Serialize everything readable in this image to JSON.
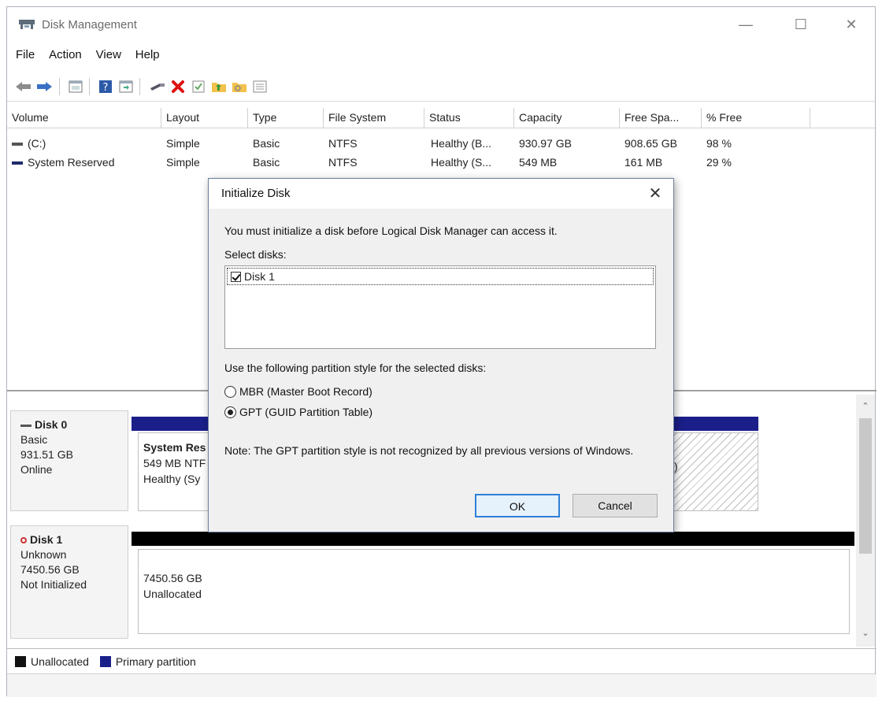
{
  "window": {
    "title": "Disk Management"
  },
  "menu": [
    "File",
    "Action",
    "View",
    "Help"
  ],
  "volume_table": {
    "columns": [
      "Volume",
      "Layout",
      "Type",
      "File System",
      "Status",
      "Capacity",
      "Free Spa...",
      "% Free"
    ],
    "rows": [
      [
        "(C:)",
        "Simple",
        "Basic",
        "NTFS",
        "Healthy (B...",
        "930.97 GB",
        "908.65 GB",
        "98 %"
      ],
      [
        "System Reserved",
        "Simple",
        "Basic",
        "NTFS",
        "Healthy (S...",
        "549 MB",
        "161 MB",
        "29 %"
      ]
    ]
  },
  "disks": [
    {
      "name": "Disk 0",
      "type": "Basic",
      "size": "931.51 GB",
      "status": "Online",
      "partition": {
        "name": "System Res",
        "line2": "549 MB NTF",
        "line3": "Healthy (Sy"
      },
      "partition_right_fragment": ")"
    },
    {
      "name": "Disk 1",
      "type": "Unknown",
      "size": "7450.56 GB",
      "status": "Not Initialized",
      "partition": {
        "size": "7450.56 GB",
        "label": "Unallocated"
      }
    }
  ],
  "legend": [
    {
      "label": "Unallocated",
      "color": "#111111"
    },
    {
      "label": "Primary partition",
      "color": "#1a1f8a"
    }
  ],
  "dialog": {
    "title": "Initialize Disk",
    "message": "You must initialize a disk before Logical Disk Manager can access it.",
    "select_label": "Select disks:",
    "disks": [
      {
        "label": "Disk 1",
        "checked": true
      }
    ],
    "style_label": "Use the following partition style for the selected disks:",
    "options": [
      {
        "label": "MBR (Master Boot Record)",
        "selected": false
      },
      {
        "label": "GPT (GUID Partition Table)",
        "selected": true
      }
    ],
    "note": "Note: The GPT partition style is not recognized by all previous versions of Windows.",
    "ok": "OK",
    "cancel": "Cancel"
  }
}
